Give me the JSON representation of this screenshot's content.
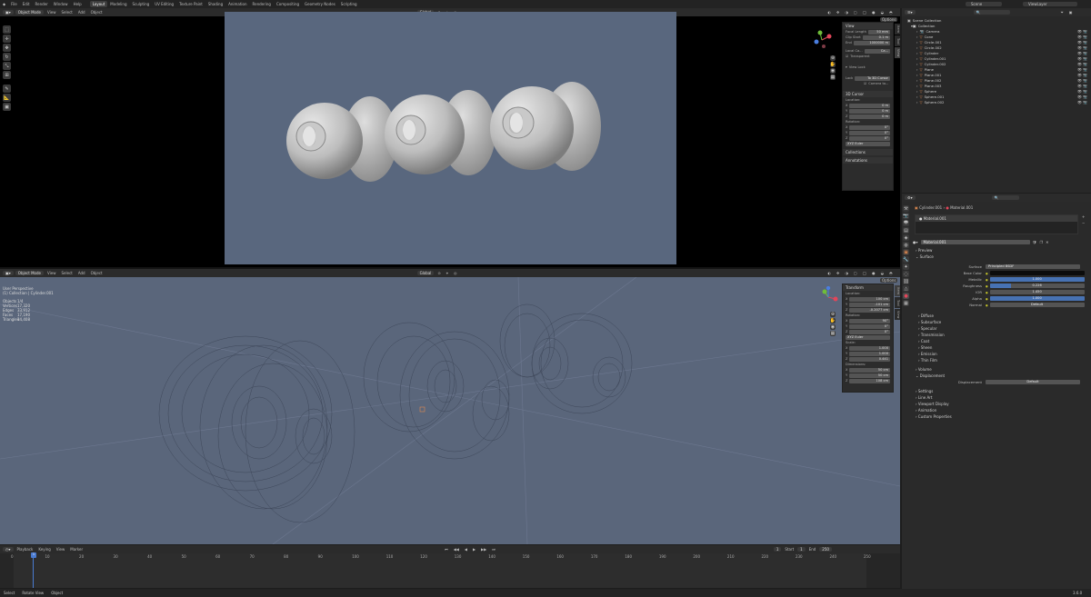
{
  "topbar": {
    "menus": [
      "File",
      "Edit",
      "Render",
      "Window",
      "Help"
    ],
    "workspaces": [
      "Layout",
      "Modeling",
      "Sculpting",
      "UV Editing",
      "Texture Paint",
      "Shading",
      "Animation",
      "Rendering",
      "Compositing",
      "Geometry Nodes",
      "Scripting"
    ],
    "active_workspace": "Layout",
    "scene": "Scene",
    "view_layer": "ViewLayer"
  },
  "viewport_top": {
    "mode": "Object Mode",
    "menus": [
      "View",
      "Select",
      "Add",
      "Object"
    ],
    "orientation": "Global",
    "options": "Options",
    "npanel": {
      "view_title": "View",
      "focal_label": "Focal Length",
      "focal_value": "50 mm",
      "clip_start_label": "Clip Start",
      "clip_start_value": "0.1 m",
      "end_label": "End",
      "end_value": "1000000 m",
      "local_camera_label": "Local Ca...",
      "local_camera_value": "Ca...",
      "render_region": "Transparent",
      "view_lock": "View Lock",
      "lock_label": "Lock",
      "lock_value": "To 3D Cursor",
      "lock_camera": "Camera to...",
      "cursor_title": "3D Cursor",
      "location_label": "Location:",
      "loc_x": "0 m",
      "loc_y": "0 m",
      "loc_z": "0 m",
      "rotation_label": "Rotation:",
      "rot_x": "0°",
      "rot_y": "0°",
      "rot_z": "0°",
      "rot_mode": "XYZ Euler",
      "collections": "Collections",
      "annotations": "Annotations"
    },
    "tabs": [
      "Item",
      "Tool",
      "View"
    ]
  },
  "viewport_bottom": {
    "mode": "Object Mode",
    "menus": [
      "View",
      "Select",
      "Add",
      "Object"
    ],
    "orientation": "Global",
    "options": "Options",
    "overlay_title": "User Perspective",
    "overlay_sub": "(1) Collection | Cylinder.001",
    "stats": [
      {
        "label": "Objects",
        "value": "1/4"
      },
      {
        "label": "Vertices",
        "value": "17,320"
      },
      {
        "label": "Edges",
        "value": "33,912"
      },
      {
        "label": "Faces",
        "value": "17,190"
      },
      {
        "label": "Triangles",
        "value": "34,408"
      }
    ],
    "npanel": {
      "title": "Transform",
      "location_label": "Location:",
      "loc_x": "100 cm",
      "loc_y": "-101 cm",
      "loc_z": "-0.2077 cm",
      "rotation_label": "Rotation:",
      "rot_x": "90°",
      "rot_y": "0°",
      "rot_z": "0°",
      "rot_mode": "XYZ Euler",
      "scale_label": "Scale:",
      "scale_x": "1.000",
      "scale_y": "1.000",
      "scale_z": "0.441",
      "dims_label": "Dimensions:",
      "dim_x": "50 cm",
      "dim_y": "50 cm",
      "dim_z": "108 cm"
    },
    "tabs": [
      "Item",
      "Tool",
      "View"
    ]
  },
  "timeline": {
    "menus": [
      "Playback",
      "Keying",
      "View",
      "Marker"
    ],
    "current_frame": "1",
    "start_label": "Start",
    "start": "1",
    "end_label": "End",
    "end": "250",
    "ticks": [
      "0",
      "10",
      "20",
      "30",
      "40",
      "50",
      "60",
      "70",
      "80",
      "90",
      "100",
      "110",
      "120",
      "130",
      "140",
      "150",
      "160",
      "170",
      "180",
      "190",
      "200",
      "210",
      "220",
      "230",
      "240",
      "250"
    ]
  },
  "statusbar": {
    "items": [
      "Select",
      "Rotate View",
      "Object"
    ],
    "version": "3.6.0"
  },
  "outliner": {
    "search_placeholder": "",
    "scene_collection": "Scene Collection",
    "collection": "Collection",
    "objects": [
      "Camera",
      "Cone",
      "Circle.001",
      "Circle.002",
      "Cylinder",
      "Cylinder.001",
      "Cylinder.002",
      "Plane",
      "Plane.001",
      "Plane.002",
      "Plane.003",
      "Sphere",
      "Sphere.001",
      "Sphere.002"
    ]
  },
  "properties": {
    "breadcrumb_obj": "Cylinder.001",
    "breadcrumb_mat": "Material.001",
    "slot": "Material.001",
    "material_name": "Material.001",
    "sections": {
      "preview": "Preview",
      "surface": "Surface"
    },
    "surface_label": "Surface",
    "surface_value": "Principled BSDF",
    "rows": [
      {
        "label": "Base Color",
        "value": ""
      },
      {
        "label": "Metallic",
        "value": "1.000",
        "fill": 1.0
      },
      {
        "label": "Roughness",
        "value": "0.226",
        "fill": 0.226
      },
      {
        "label": "IOR",
        "value": "1.450",
        "fill": 0
      },
      {
        "label": "Alpha",
        "value": "1.000",
        "fill": 1.0
      },
      {
        "label": "Normal",
        "value": "Default",
        "fill": 0
      }
    ],
    "subsections": [
      "Diffuse",
      "Subsurface",
      "Specular",
      "Transmission",
      "Coat",
      "Sheen",
      "Emission",
      "Thin Film"
    ],
    "volume": "Volume",
    "displacement": "Displacement",
    "displacement_label": "Displacement",
    "displacement_value": "Default",
    "tail": [
      "Settings",
      "Line Art",
      "Viewport Display",
      "Animation",
      "Custom Properties"
    ]
  }
}
